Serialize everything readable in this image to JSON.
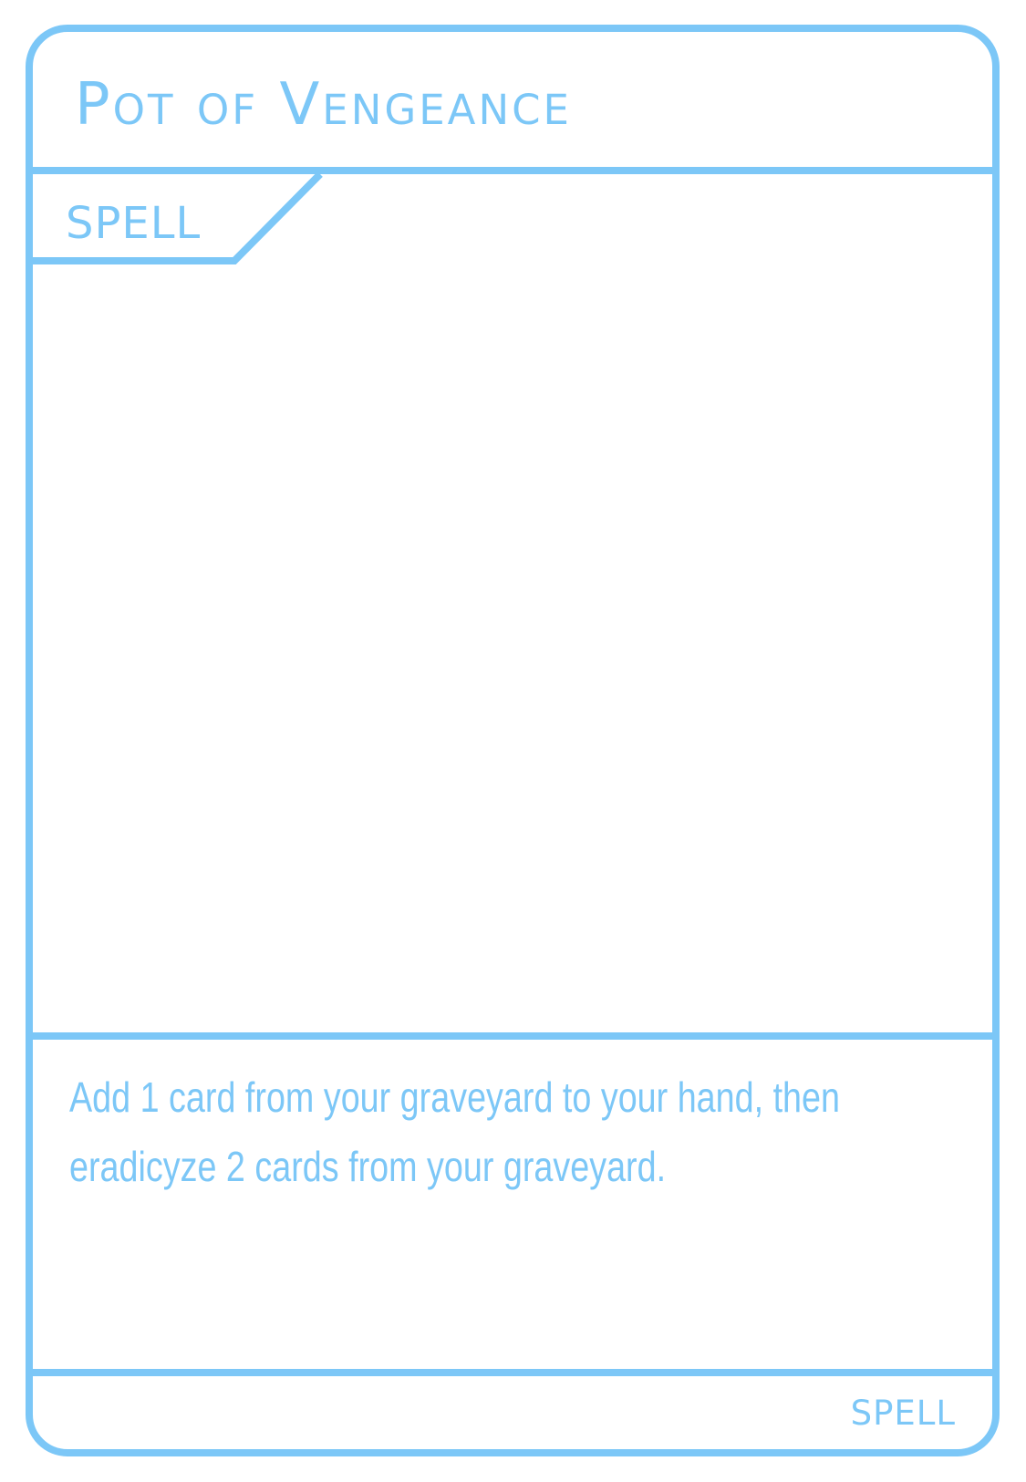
{
  "card": {
    "name": "Pot of Vengeance",
    "type_tab": "SPELL",
    "effect": "Add 1 card from your graveyard to your hand, then eradicyze 2 cards from your graveyard.",
    "footer_type": "SPELL"
  },
  "colors": {
    "accent": "#7cc7f7",
    "background": "#ffffff"
  }
}
